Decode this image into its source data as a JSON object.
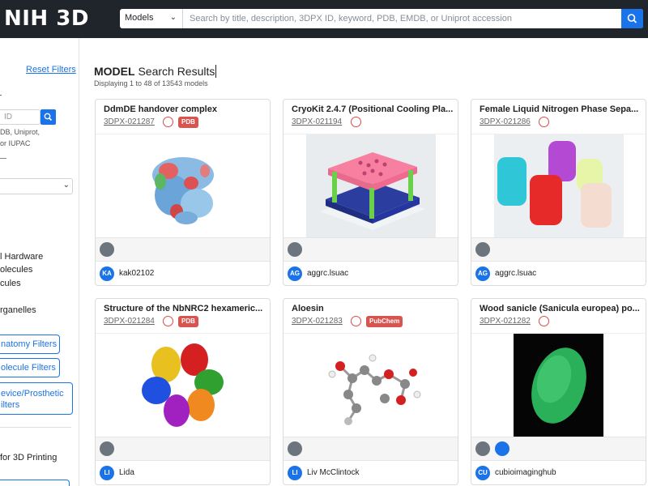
{
  "header": {
    "logo": "NIH 3D",
    "search_type": "Models",
    "search_placeholder": "Search by title, description, 3DPX ID, keyword, PDB, EMDB, or Uniprot accession"
  },
  "sidebar": {
    "reset_filters": "Reset Filters",
    "id_placeholder": "ID",
    "id_hint": [
      "DB, Uniprot,",
      "or IUPAC"
    ],
    "options": [
      "l Hardware",
      "olecules",
      "cules",
      "rganelles"
    ],
    "buttons": [
      "natomy Filters",
      "olecule Filters"
    ],
    "device_button": [
      "evice/Prosthetic",
      "ilters"
    ],
    "printing": "for 3D Printing"
  },
  "results": {
    "title_bold": "MODEL",
    "title_rest": " Search Results",
    "subtitle": "Displaying 1 to 48 of 13543 models"
  },
  "cards": [
    {
      "title": "DdmDE handover complex",
      "id": "3DPX-021287",
      "badge": "PDB",
      "user_initials": "KA",
      "user": "kak02102",
      "icon1": "dna-icon"
    },
    {
      "title": "CryoKit 2.4.7 (Positional Cooling Pla...",
      "id": "3DPX-021194",
      "badge": "",
      "user_initials": "AG",
      "user": "aggrc.lsuac",
      "icon1": "flask-icon"
    },
    {
      "title": "Female Liquid Nitrogen Phase Sepa...",
      "id": "3DPX-021286",
      "badge": "",
      "user_initials": "AG",
      "user": "aggrc.lsuac",
      "icon1": "flask-icon"
    },
    {
      "title": "Structure of the NbNRC2 hexameric...",
      "id": "3DPX-021284",
      "badge": "PDB",
      "user_initials": "LI",
      "user": "Lida",
      "icon1": "dna-icon"
    },
    {
      "title": "Aloesin",
      "id": "3DPX-021283",
      "badge": "PubChem",
      "user_initials": "LI",
      "user": "Liv McClintock",
      "icon1": "molecule-icon"
    },
    {
      "title": "Wood sanicle (Sanicula europea) po...",
      "id": "3DPX-021282",
      "badge": "",
      "user_initials": "CU",
      "user": "cubioimaginghub",
      "icon1": "pill-icon"
    }
  ],
  "colors": {
    "topbar": "#20252b",
    "accent": "#1a73e8",
    "badge": "#d9534f"
  }
}
